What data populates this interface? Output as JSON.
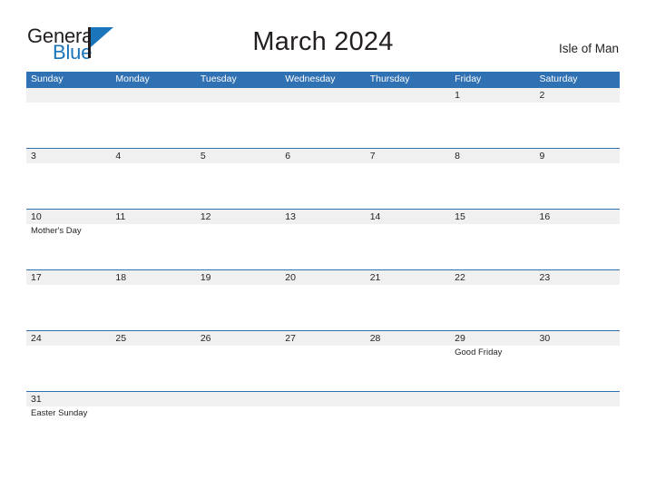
{
  "header": {
    "brand": {
      "word_one": "General",
      "word_two": "Blue",
      "color_dark": "#231f20",
      "color_blue": "#1b75bb"
    },
    "title": "March 2024",
    "location": "Isle of Man"
  },
  "calendar": {
    "accent_color": "#3071b4",
    "date_band_color": "#f0f0f0",
    "weekdays": [
      "Sunday",
      "Monday",
      "Tuesday",
      "Wednesday",
      "Thursday",
      "Friday",
      "Saturday"
    ],
    "weeks": [
      {
        "days": [
          {
            "number": "",
            "event": ""
          },
          {
            "number": "",
            "event": ""
          },
          {
            "number": "",
            "event": ""
          },
          {
            "number": "",
            "event": ""
          },
          {
            "number": "",
            "event": ""
          },
          {
            "number": "1",
            "event": ""
          },
          {
            "number": "2",
            "event": ""
          }
        ]
      },
      {
        "days": [
          {
            "number": "3",
            "event": ""
          },
          {
            "number": "4",
            "event": ""
          },
          {
            "number": "5",
            "event": ""
          },
          {
            "number": "6",
            "event": ""
          },
          {
            "number": "7",
            "event": ""
          },
          {
            "number": "8",
            "event": ""
          },
          {
            "number": "9",
            "event": ""
          }
        ]
      },
      {
        "days": [
          {
            "number": "10",
            "event": "Mother's Day"
          },
          {
            "number": "11",
            "event": ""
          },
          {
            "number": "12",
            "event": ""
          },
          {
            "number": "13",
            "event": ""
          },
          {
            "number": "14",
            "event": ""
          },
          {
            "number": "15",
            "event": ""
          },
          {
            "number": "16",
            "event": ""
          }
        ]
      },
      {
        "days": [
          {
            "number": "17",
            "event": ""
          },
          {
            "number": "18",
            "event": ""
          },
          {
            "number": "19",
            "event": ""
          },
          {
            "number": "20",
            "event": ""
          },
          {
            "number": "21",
            "event": ""
          },
          {
            "number": "22",
            "event": ""
          },
          {
            "number": "23",
            "event": ""
          }
        ]
      },
      {
        "days": [
          {
            "number": "24",
            "event": ""
          },
          {
            "number": "25",
            "event": ""
          },
          {
            "number": "26",
            "event": ""
          },
          {
            "number": "27",
            "event": ""
          },
          {
            "number": "28",
            "event": ""
          },
          {
            "number": "29",
            "event": "Good Friday"
          },
          {
            "number": "30",
            "event": ""
          }
        ]
      },
      {
        "days": [
          {
            "number": "31",
            "event": "Easter Sunday"
          },
          {
            "number": "",
            "event": ""
          },
          {
            "number": "",
            "event": ""
          },
          {
            "number": "",
            "event": ""
          },
          {
            "number": "",
            "event": ""
          },
          {
            "number": "",
            "event": ""
          },
          {
            "number": "",
            "event": ""
          }
        ]
      }
    ]
  }
}
